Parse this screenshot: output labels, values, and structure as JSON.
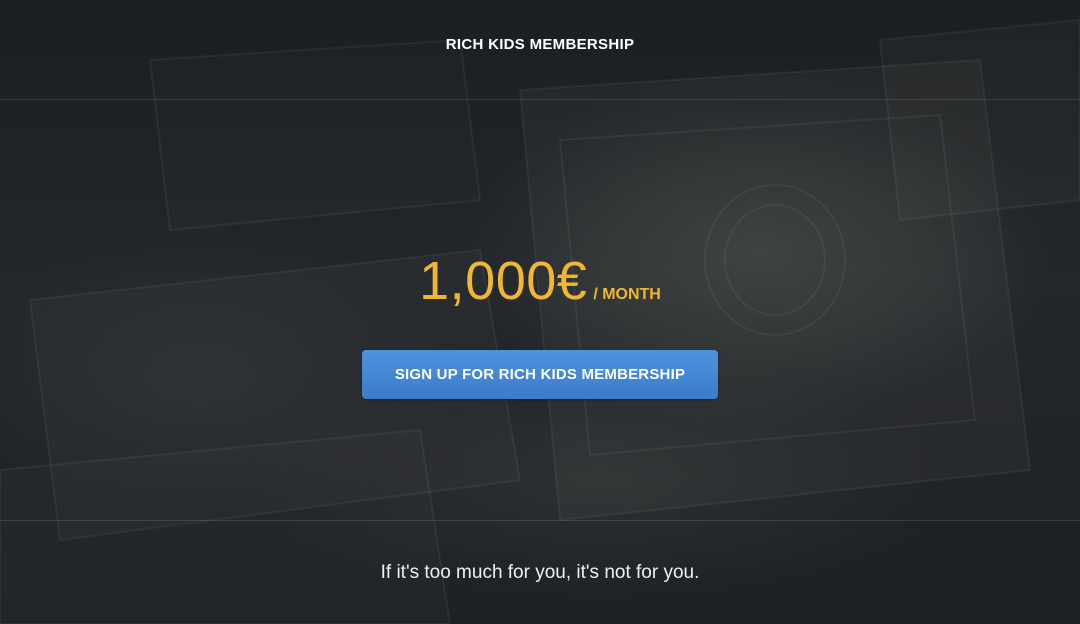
{
  "header": {
    "title": "RICH KIDS MEMBERSHIP"
  },
  "pricing": {
    "amount": "1,000€",
    "period": "/ MONTH"
  },
  "cta": {
    "label": "SIGN UP FOR RICH KIDS MEMBERSHIP"
  },
  "footer": {
    "tagline": "If it's too much for you, it's not for you."
  },
  "colors": {
    "price": "#f2b731",
    "button": "#4587d4",
    "background": "#1b1e22"
  },
  "background_image": "banknotes-photo"
}
